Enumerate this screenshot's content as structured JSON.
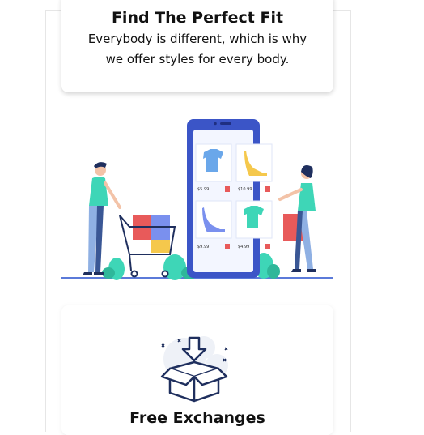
{
  "fit_card": {
    "title": "Find The Perfect Fit",
    "description": "Everybody is different, which is why we offer styles for every body."
  },
  "illustration": {
    "products": [
      {
        "name": "t-shirt-blue",
        "price": "$5.99"
      },
      {
        "name": "heel-yellow",
        "price": "$10.99"
      },
      {
        "name": "heel-purple",
        "price": "$9.99"
      },
      {
        "name": "t-shirt-teal",
        "price": "$4.99"
      }
    ]
  },
  "exchange_card": {
    "title": "Free Exchanges",
    "icon": "open-box-icon"
  },
  "colors": {
    "phone": "#3b55c7",
    "accent_teal": "#3ed6b7",
    "accent_red": "#e85a5a",
    "accent_yellow": "#f5c84c",
    "ground": "#5b7ad9"
  }
}
